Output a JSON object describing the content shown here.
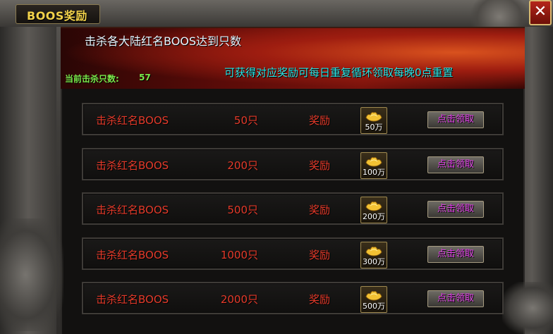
{
  "window": {
    "title": "BOOS奖励",
    "close_label": "✕"
  },
  "banner": {
    "heading": "击杀各大陆红名BOOS达到只数",
    "kill_count_label": "当前击杀只数:",
    "kill_count_value": "57",
    "description": "可获得对应奖励可每日重复循环领取每晚0点重置"
  },
  "rows": [
    {
      "label": "击杀红名BOOS",
      "count": "50只",
      "reward_label": "奖励",
      "amount": "50万",
      "button": "点击领取"
    },
    {
      "label": "击杀红名BOOS",
      "count": "200只",
      "reward_label": "奖励",
      "amount": "100万",
      "button": "点击领取"
    },
    {
      "label": "击杀红名BOOS",
      "count": "500只",
      "reward_label": "奖励",
      "amount": "200万",
      "button": "点击领取"
    },
    {
      "label": "击杀红名BOOS",
      "count": "1000只",
      "reward_label": "奖励",
      "amount": "300万",
      "button": "点击领取"
    },
    {
      "label": "击杀红名BOOS",
      "count": "2000只",
      "reward_label": "奖励",
      "amount": "500万",
      "button": "点击领取"
    }
  ],
  "colors": {
    "title": "#f2d24a",
    "row_text": "#e43a2a",
    "kill_count": "#7be84a",
    "description": "#2ae5e5",
    "claim_button_text": "#e040e8"
  },
  "icons": {
    "close": "close-icon",
    "reward": "gold-ingot-icon"
  }
}
